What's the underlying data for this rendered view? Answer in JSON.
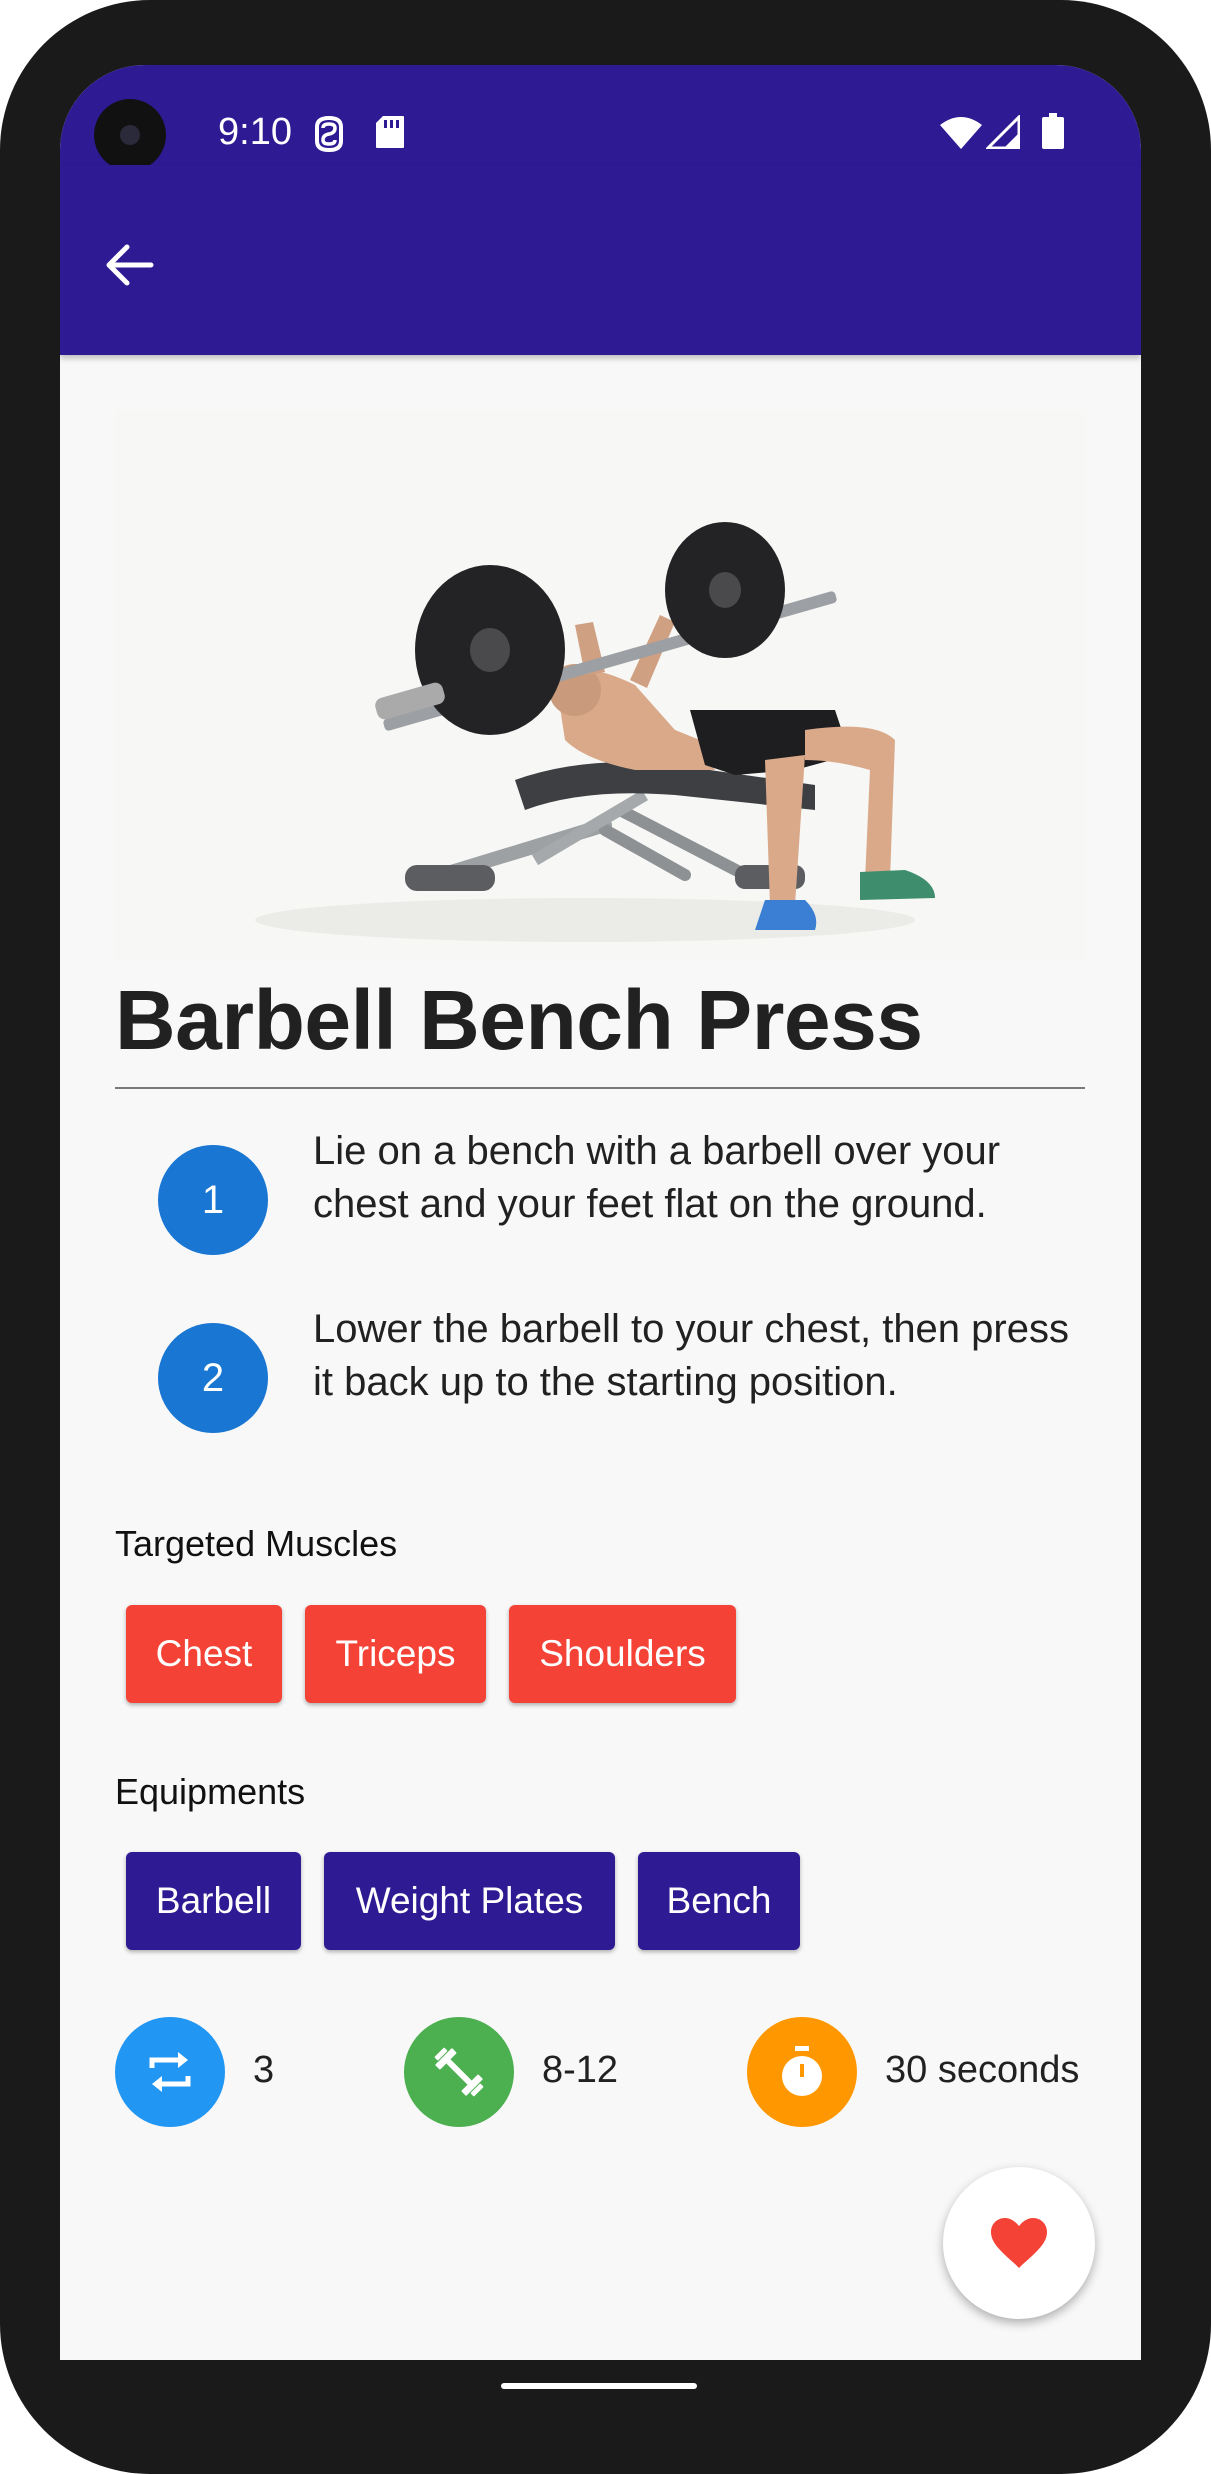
{
  "status_bar": {
    "time": "9:10"
  },
  "app_bar": {
    "back_icon": "arrow-back-icon"
  },
  "exercise": {
    "title": "Barbell Bench Press",
    "image_icon": "bench-press-illustration"
  },
  "steps": [
    {
      "number": "1",
      "text": "Lie on a bench with a barbell over your chest and your feet flat on the ground."
    },
    {
      "number": "2",
      "text": "Lower the barbell to your chest, then press it back up to the starting position."
    }
  ],
  "targeted_muscles": {
    "label": "Targeted Muscles",
    "items": [
      "Chest",
      "Triceps",
      "Shoulders"
    ]
  },
  "equipments": {
    "label": "Equipments",
    "items": [
      "Barbell",
      "Weight Plates",
      "Bench"
    ]
  },
  "stats": {
    "sets": {
      "icon": "repeat-icon",
      "value": "3"
    },
    "reps": {
      "icon": "dumbbell-icon",
      "value": "8-12"
    },
    "rest": {
      "icon": "timer-icon",
      "value": "30 seconds"
    }
  },
  "fab": {
    "icon": "heart-icon"
  },
  "colors": {
    "primary": "#2e1a93",
    "muscle_chip": "#f44336",
    "step_circle": "#1976d2",
    "sets_icon_bg": "#2196f3",
    "reps_icon_bg": "#4caf50",
    "rest_icon_bg": "#ff9800",
    "favorite": "#f44336"
  }
}
